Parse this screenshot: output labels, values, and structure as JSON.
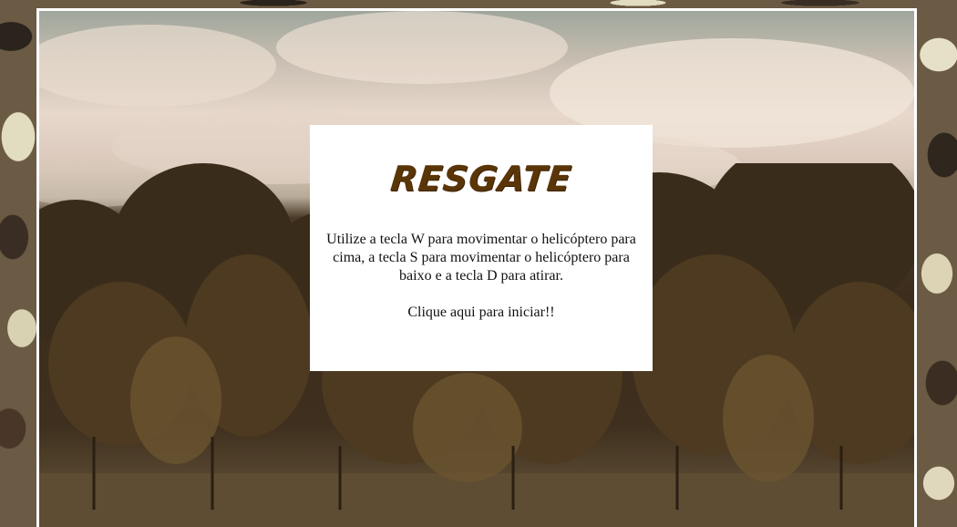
{
  "game": {
    "title": "RESGATE",
    "instructions": "Utilize a tecla W para movimentar o helicóptero para cima, a tecla S para movimentar o helicóptero para baixo e a tecla D para atirar.",
    "start_label": "Clique aqui para iniciar!!"
  },
  "colors": {
    "title_color": "#5a3508",
    "frame_border": "#ffffff",
    "dialog_background": "#ffffff"
  },
  "icons": [
    "camouflage-pattern",
    "forest-landscape"
  ]
}
